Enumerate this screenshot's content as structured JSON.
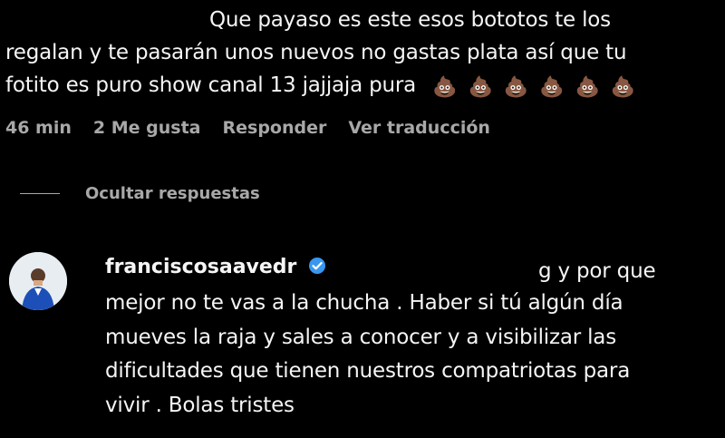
{
  "comment": {
    "lines": [
      "Que payaso es este esos bototos te los",
      "regalan y te pasarán unos nuevos no gastas plata así que tu",
      "fotito es puro show canal 13 jajjaja pura"
    ],
    "emoji": [
      "pile-of-poo",
      "pile-of-poo",
      "pile-of-poo",
      "pile-of-poo",
      "pile-of-poo",
      "pile-of-poo"
    ],
    "meta": {
      "time": "46 min",
      "likes": "2 Me gusta",
      "reply": "Responder",
      "translate": "Ver traducción"
    }
  },
  "thread": {
    "hide_replies": "Ocultar respuestas"
  },
  "reply": {
    "username": "franciscosaavedr",
    "visible_start": "g y por que",
    "lines": [
      "mejor no te vas a la chucha . Haber si tú algún día",
      "mueves la raja y sales a conocer y a visibilizar las",
      "dificultades que tienen nuestros compatriotas para",
      "vivir . Bolas tristes"
    ],
    "verified_color": "#3897f0"
  }
}
